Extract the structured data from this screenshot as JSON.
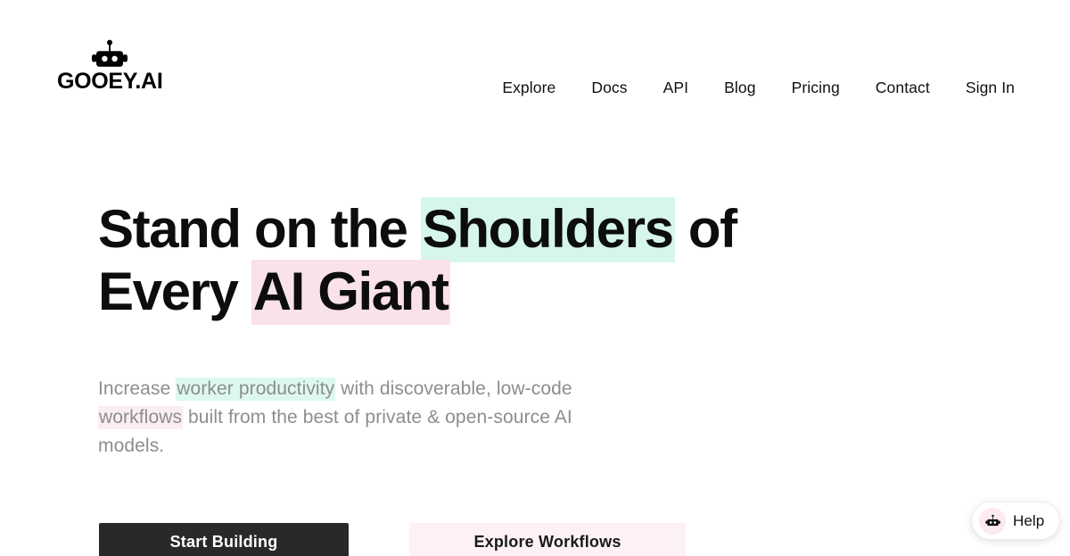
{
  "brand": {
    "name": "GOOEY.AI",
    "logo_icon": "robot-head-icon"
  },
  "nav": {
    "items": [
      {
        "label": "Explore"
      },
      {
        "label": "Docs"
      },
      {
        "label": "API"
      },
      {
        "label": "Blog"
      },
      {
        "label": "Pricing"
      },
      {
        "label": "Contact"
      },
      {
        "label": "Sign In"
      }
    ]
  },
  "hero": {
    "headline": {
      "line1_pre": "Stand on the ",
      "line1_highlight": "Shoulders",
      "line1_post": " of",
      "line2_pre": "Every ",
      "line2_highlight": "AI Giant"
    },
    "subhead": {
      "part1": "Increase ",
      "highlight_mint": "worker productivity",
      "part2": " with discoverable, low-code ",
      "highlight_pink": "workflows",
      "part3": " built from the best of private & open-source AI models."
    }
  },
  "cta": {
    "primary_label": "Start Building",
    "secondary_label": "Explore Workflows"
  },
  "help": {
    "label": "Help",
    "icon": "robot-head-icon"
  },
  "colors": {
    "mint_highlight": "#d6f6ec",
    "pink_highlight": "#fae2e9",
    "subhead_mint": "#ddf8f0",
    "subhead_pink": "#fbeef2",
    "primary_button_bg": "#292929",
    "secondary_button_bg": "#fdf1f5",
    "text_dark": "#111111",
    "text_muted": "#8d8d8d",
    "page_bg": "#ffffff",
    "help_bot_bg": "#fbeaf0"
  }
}
